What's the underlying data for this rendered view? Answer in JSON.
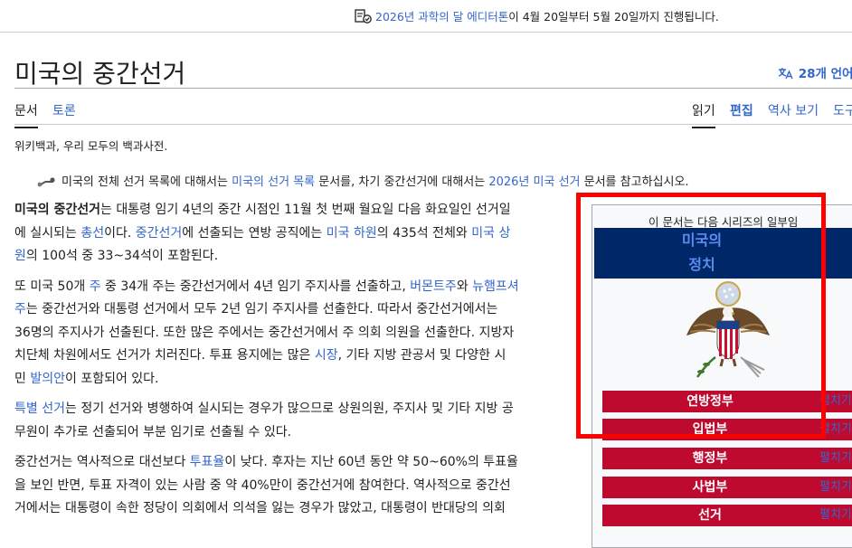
{
  "banner": {
    "link": "2026년 과학의 달 에디터톤",
    "text": "이 4월 20일부터 5월 20일까지 진행됩니다."
  },
  "page": {
    "title": "미국의 중간선거",
    "languages": "28개 언어",
    "tagline": "위키백과, 우리 모두의 백과사전."
  },
  "tabs": {
    "article": "문서",
    "talk": "토론",
    "read": "읽기",
    "edit": "편집",
    "history": "역사 보기",
    "tools": "도구"
  },
  "hatnote": {
    "t1": "미국의 전체 선거 목록에 대해서는 ",
    "l1": "미국의 선거 목록",
    "t2": " 문서를, 차기 중간선거에 대해서는 ",
    "l2": "2026년 미국 선거",
    "t3": " 문서를 참고하십시오."
  },
  "content": {
    "p1": {
      "bold": "미국의 중간선거",
      "t1": "는 대통령 임기 4년의 중간 시점인 11월 첫 번째 월요일 다음 화요일인 선거일",
      "t2": "에 실시되는 ",
      "l1": "총선",
      "t3": "이다. ",
      "l2": "중간선거",
      "t4": "에 선출되는 연방 공직에는 ",
      "l3": "미국 하원",
      "t5": "의 435석 전체와 ",
      "l4": "미국 상",
      "l5": "원",
      "t6": "의 100석 중 33~34석이 포함된다."
    },
    "p2": {
      "t1": "또 미국 50개 ",
      "l1": "주",
      "t2": " 중 34개 주는 중간선거에서 4년 임기 주지사를 선출하고, ",
      "l2": "버몬트주",
      "t3": "와 ",
      "l3": "뉴햄프셔",
      "l4": "주",
      "t4": "는 중간선거와 대통령 선거에서 모두 2년 임기 주지사를 선출한다. 따라서 중간선거에서는",
      "t5": "36명의 주지사가 선출된다. 또한 많은 주에서는 중간선거에서 주 의회 의원을 선출한다. 지방자",
      "t6": "치단체 차원에서도 선거가 치러진다. 투표 용지에는 많은 ",
      "l5": "시장",
      "t7": ", 기타 지방 관공서 및 다양한 시",
      "t8": "민 ",
      "l6": "발의안",
      "t9": "이 포함되어 있다."
    },
    "p3": {
      "l1": "특별 선거",
      "t1": "는 정기 선거와 병행하여 실시되는 경우가 많으므로 상원의원, 주지사 및 기타 지방 공",
      "t2": "무원이 추가로 선출되어 부분 임기로 선출될 수 있다."
    },
    "p4": {
      "t1": "중간선거는 역사적으로 대선보다 ",
      "l1": "투표율",
      "t2": "이 낮다. 후자는 지난 60년 동안 약 50~60%의 투표율",
      "t3": "을 보인 반면, 투표 자격이 있는 사람 중 약 40%만이 중간선거에 참여한다. 역사적으로 중간선",
      "t4": "거에서는 대통령이 속한 정당이 의회에서 의석을 잃는 경우가 많았고, 대통령이 반대당의 의회"
    }
  },
  "infobox": {
    "caption": "이 문서는 다음 시리즈의 일부임",
    "header_line1": "미국의",
    "header_line2": "정치",
    "expand_label": "펼치기",
    "sections": [
      "연방정부",
      "입법부",
      "행정부",
      "사법부",
      "선거"
    ]
  },
  "colors": {
    "link": "#3366cc",
    "infobox_header_bg": "#002868",
    "infobox_row_bg": "#bf0a30",
    "highlight_box": "#ff0000"
  }
}
